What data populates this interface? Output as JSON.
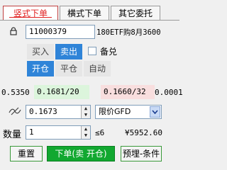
{
  "tabs": [
    "竖式下单",
    "横式下单",
    "其它委托"
  ],
  "contract_code": "11000379",
  "contract_name": "180ETF购8月3600",
  "side_buttons": [
    "买入",
    "卖出"
  ],
  "covered_label": "备兑",
  "open_close_buttons": [
    "开仓",
    "平仓",
    "自动"
  ],
  "quote": {
    "last": "0.5350",
    "bid": "0.1681/20",
    "ask": "0.1660/32",
    "tick": "0.0001"
  },
  "price_value": "0.1673",
  "order_type": "限价GFD",
  "qty_label": "数量",
  "qty_value": "1",
  "max_qty": "≤6",
  "amount": "¥5952.60",
  "buttons": {
    "reset": "重置",
    "submit": "下单(卖 开仓)",
    "preset": "预埋-条件"
  },
  "colors": {
    "active_tab_text": "#e02020",
    "selected_blue": "#2f84d8",
    "bid_bg": "#dcf5dc",
    "ask_bg": "#f8dede",
    "submit_green": "#11a830"
  }
}
